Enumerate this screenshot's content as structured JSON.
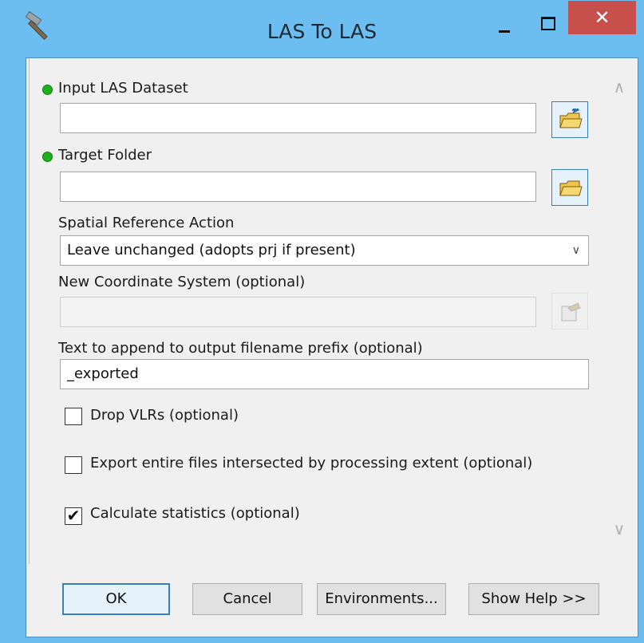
{
  "window": {
    "title": "LAS To LAS",
    "close_label": "✕"
  },
  "fields": {
    "input_las": {
      "label": "Input LAS Dataset",
      "value": ""
    },
    "target_folder": {
      "label": "Target Folder",
      "value": ""
    },
    "spatial_reference": {
      "label": "Spatial Reference Action",
      "selected": "Leave unchanged (adopts prj if present)"
    },
    "coordinate_system": {
      "label": "New Coordinate System (optional)",
      "value": ""
    },
    "prefix": {
      "label": "Text to append to output filename prefix (optional)",
      "value": "_exported"
    }
  },
  "checkboxes": [
    {
      "label": "Drop VLRs (optional)",
      "checked": false
    },
    {
      "label": "Export entire files intersected by processing extent (optional)",
      "checked": false
    },
    {
      "label": "Calculate statistics (optional)",
      "checked": true
    }
  ],
  "buttons": {
    "ok": "OK",
    "cancel": "Cancel",
    "environments": "Environments...",
    "help": "Show Help >>"
  },
  "colors": {
    "titlebar": "#6cbdf0",
    "close": "#c7504c",
    "required_dot": "#1fb01f",
    "focus_border": "#3c7fb1"
  },
  "icons": [
    "hammer-icon",
    "minimize-icon",
    "maximize-icon",
    "close-icon",
    "folder-browse-icon",
    "coordinate-system-icon",
    "chevron-down-icon",
    "scroll-up-icon",
    "scroll-down-icon"
  ]
}
